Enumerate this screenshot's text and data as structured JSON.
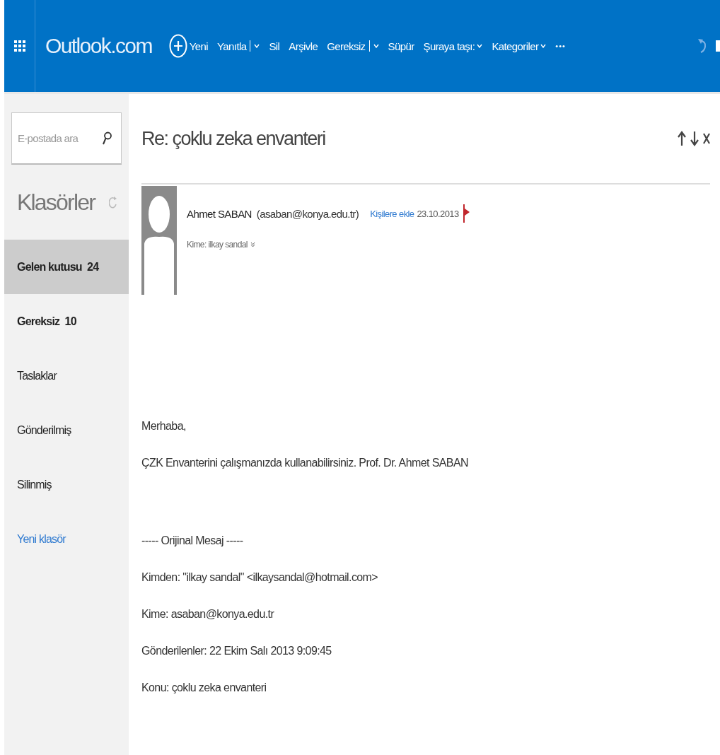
{
  "app": {
    "logo": "Outlook.com"
  },
  "toolbar": [
    {
      "label": "Yeni",
      "kind": "new"
    },
    {
      "label": "Yanıtla",
      "kind": "split"
    },
    {
      "label": "Sil",
      "kind": "plain"
    },
    {
      "label": "Arşivle",
      "kind": "plain"
    },
    {
      "label": "Gereksiz",
      "kind": "split"
    },
    {
      "label": "Süpür",
      "kind": "plain"
    },
    {
      "label": "Şuraya taşı:",
      "kind": "menu"
    },
    {
      "label": "Kategoriler",
      "kind": "menu"
    },
    {
      "label": "•••",
      "kind": "more"
    }
  ],
  "search": {
    "placeholder": "E-postada ara"
  },
  "folders": {
    "title": "Klasörler",
    "items": [
      {
        "label": "Gelen kutusu",
        "count": "24",
        "selected": true,
        "unread": true
      },
      {
        "label": "Gereksiz",
        "count": "10",
        "selected": false,
        "unread": true
      },
      {
        "label": "Taslaklar",
        "selected": false,
        "unread": false
      },
      {
        "label": "Gönderilmiş",
        "selected": false,
        "unread": false
      },
      {
        "label": "Silinmiş",
        "selected": false,
        "unread": false
      }
    ],
    "new_folder": "Yeni klasör"
  },
  "message": {
    "subject": "Re: çoklu zeka envanteri",
    "sender": "Ahmet SABAN",
    "sender_email": "(asaban@konya.edu.tr)",
    "add_contact": "Kişilere ekle",
    "date": "23.10.2013",
    "flagged": true,
    "to": "Kime: ilkay sandal",
    "body": [
      [
        "Merhaba,",
        "ÇZK Envanterini çalışmanızda kullanabilirsiniz. Prof. Dr. Ahmet SABAN"
      ],
      [
        "----- Orijinal Mesaj -----",
        "Kimden: \"ilkay sandal\" <ilkaysandal@hotmail.com>",
        "Kime: asaban@konya.edu.tr",
        "Gönderilenler: 22 Ekim Salı 2013 9:09:45",
        "Konu: çoklu zeka envanteri"
      ]
    ]
  }
}
